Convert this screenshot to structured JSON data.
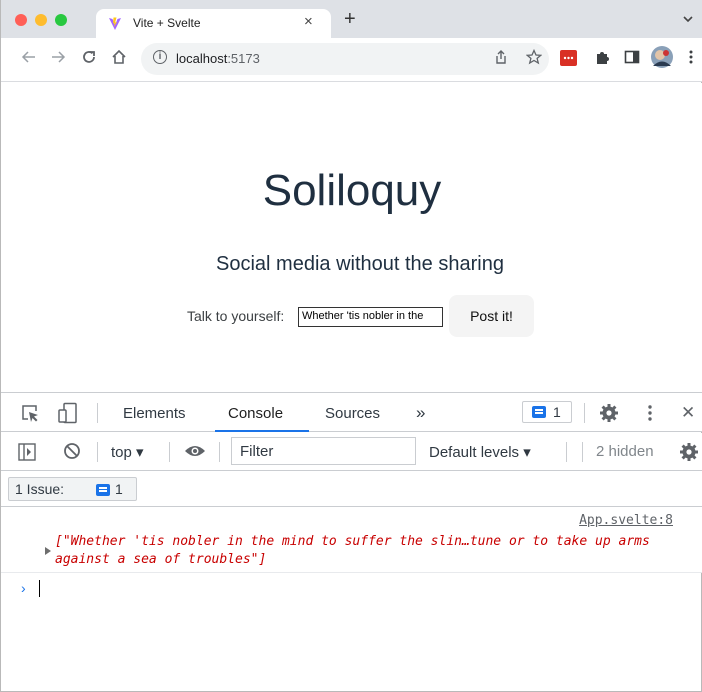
{
  "browser": {
    "tab_title": "Vite + Svelte",
    "tab_close": "×",
    "new_tab": "+",
    "tab_menu": "⌄",
    "url_host": "localhost",
    "url_port": ":5173",
    "colors": {
      "close": "#ff5f57",
      "minimize": "#febc2e",
      "zoom": "#28c840",
      "tabstrip": "#dee1e6"
    }
  },
  "page": {
    "title": "Soliloquy",
    "subtitle": "Social media without the sharing",
    "input_label": "Talk to yourself:",
    "input_value": "Whether 'tis nobler in the",
    "post_button": "Post it!"
  },
  "devtools": {
    "tabs": [
      {
        "label": "Elements"
      },
      {
        "label": "Console",
        "active": true
      },
      {
        "label": "Sources"
      }
    ],
    "more_tabs": "»",
    "issue_badge_count": "1",
    "close": "✕",
    "console_toolbar": {
      "context": "top ▾",
      "filter_placeholder": "Filter",
      "levels": "Default levels ▾",
      "hidden": "2 hidden"
    },
    "issues_bar": {
      "label": "1 Issue:",
      "count": "1"
    },
    "log": {
      "source": "App.svelte:8",
      "text": "[\"Whether 'tis nobler in the mind to suffer the slin…tune or to take up arms against a sea of troubles\"]"
    },
    "prompt": "›"
  }
}
